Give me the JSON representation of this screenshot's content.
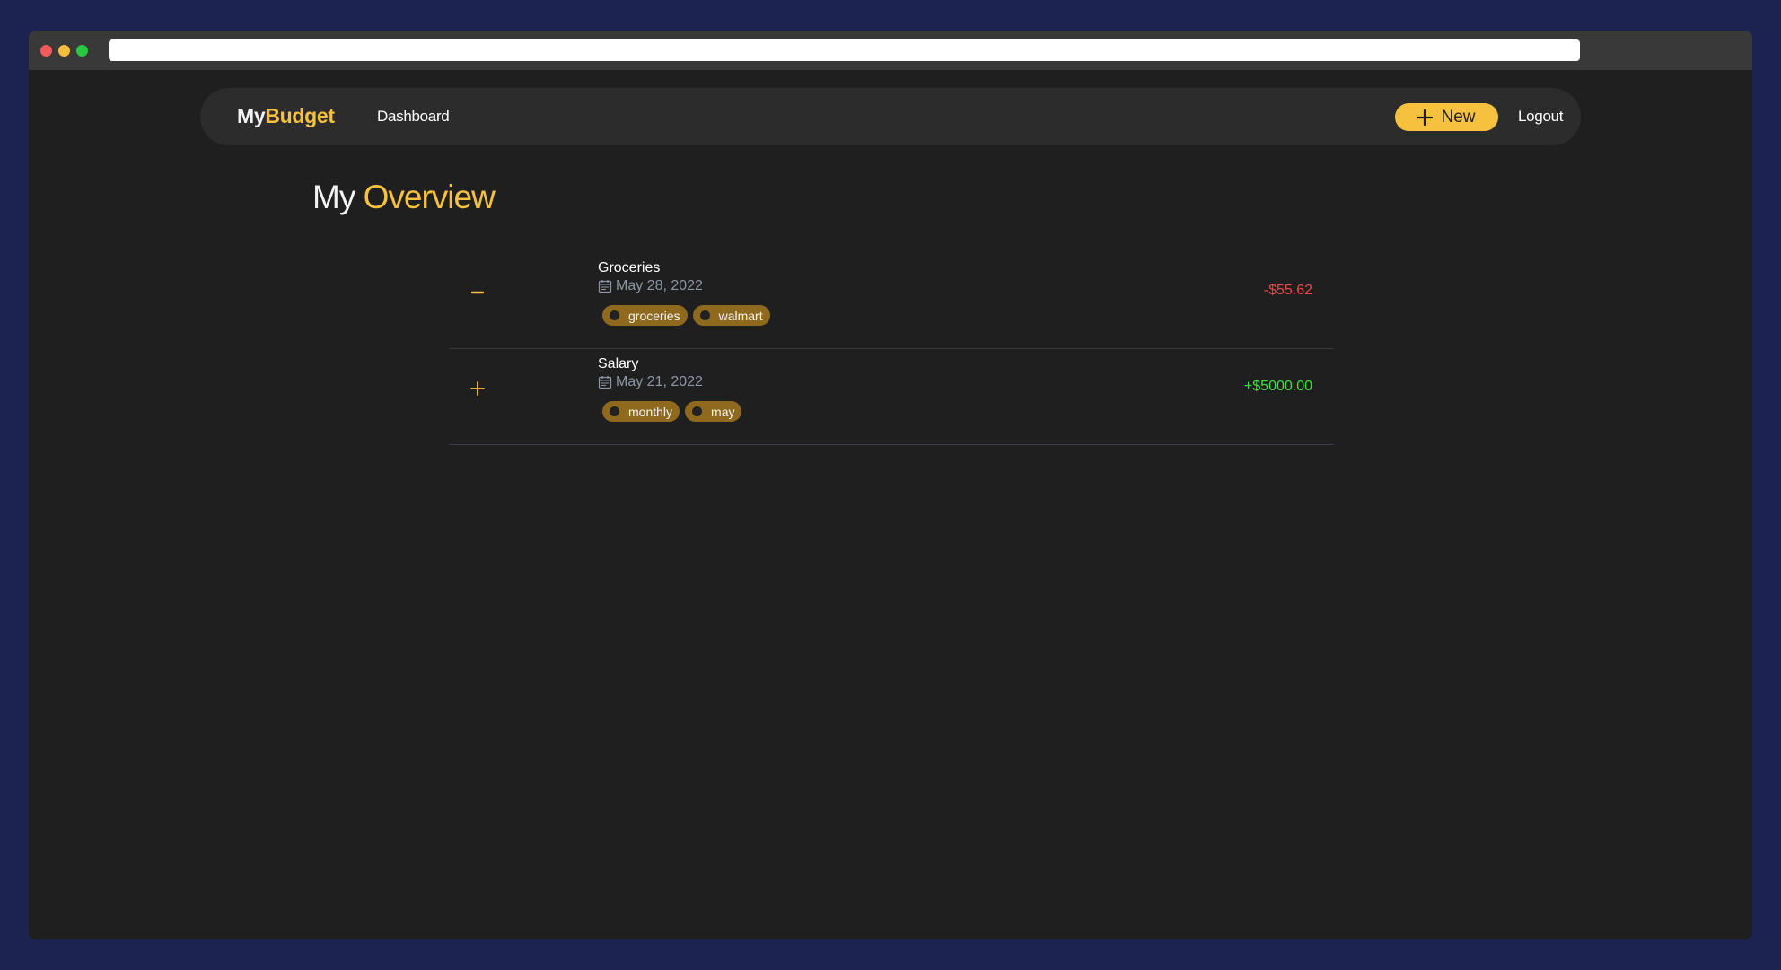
{
  "colors": {
    "accent": "#f5c13e",
    "negative": "#ef4747",
    "positive": "#3ee23e",
    "tag_bg": "#8f6a1e",
    "background": "#1f1f1f",
    "navbar": "#2c2c2c"
  },
  "navbar": {
    "brand_part1": "My",
    "brand_part2": "Budget",
    "dashboard_link": "Dashboard",
    "new_button": "New",
    "new_button_icon": "plus-icon",
    "logout_link": "Logout"
  },
  "page": {
    "title_part1": "My",
    "title_part2": "Overview"
  },
  "transactions": [
    {
      "type_icon": "minus-icon",
      "name": "Groceries",
      "date_icon": "calendar-icon",
      "date": "May 28, 2022",
      "tags": [
        "groceries",
        "walmart"
      ],
      "amount": "-$55.62",
      "direction": "expense"
    },
    {
      "type_icon": "plus-icon",
      "name": "Salary",
      "date_icon": "calendar-icon",
      "date": "May 21, 2022",
      "tags": [
        "monthly",
        "may"
      ],
      "amount": "+$5000.00",
      "direction": "income"
    }
  ]
}
